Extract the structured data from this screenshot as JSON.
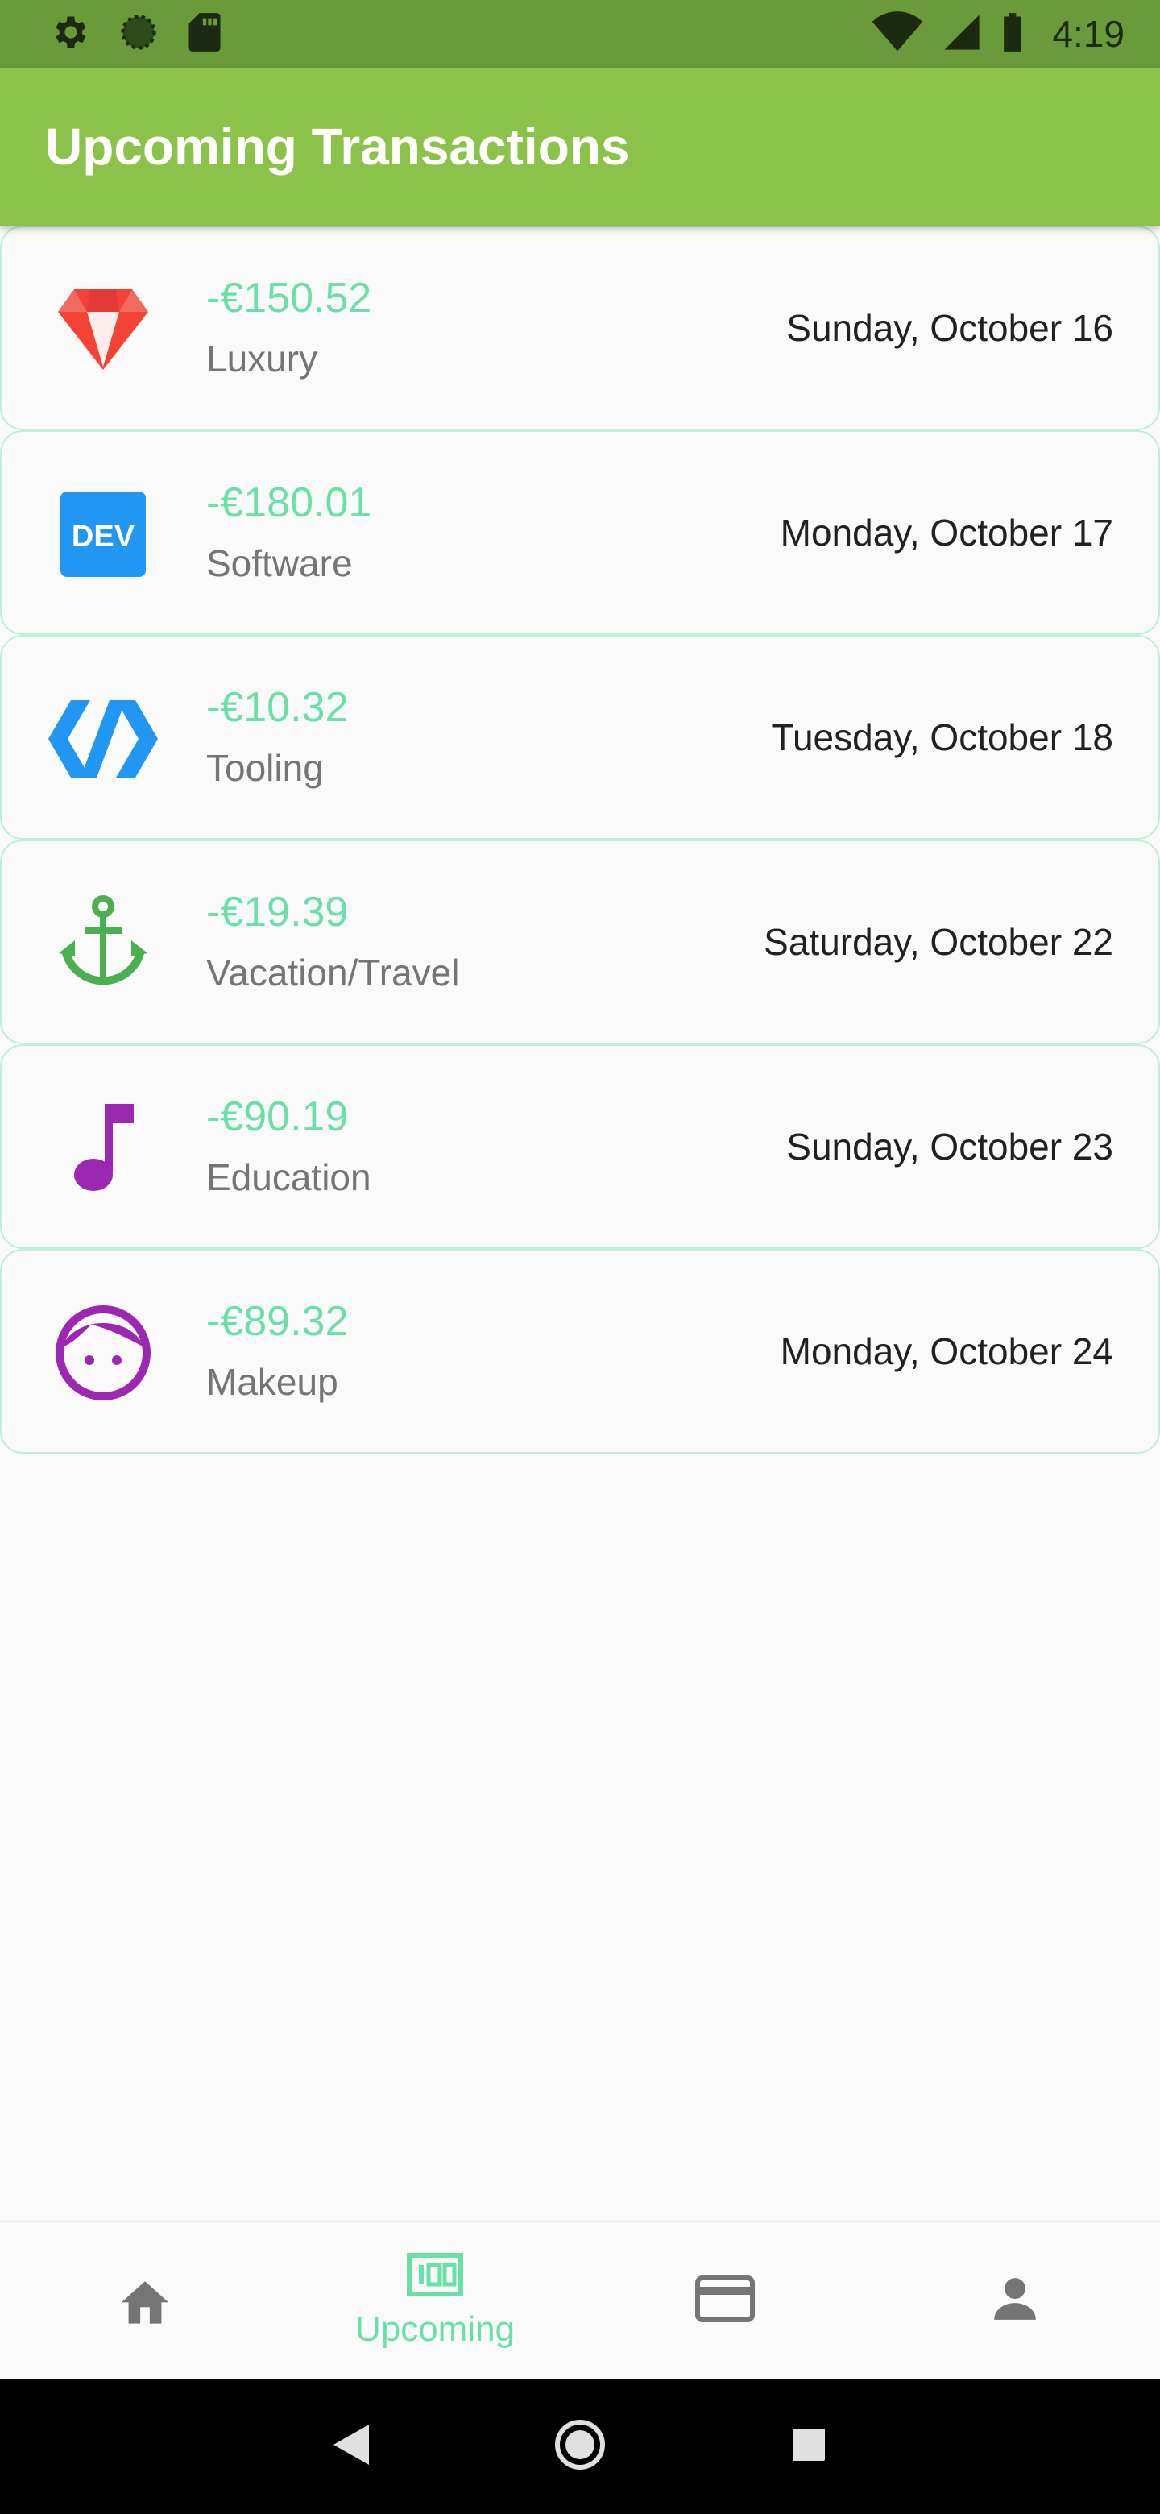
{
  "status_bar": {
    "time": "4:19",
    "icons_left": [
      "gear-icon",
      "circle-status-icon",
      "sd-card-icon"
    ],
    "icons_right": [
      "wifi-icon",
      "signal-icon",
      "battery-icon"
    ]
  },
  "app_bar": {
    "title": "Upcoming Transactions"
  },
  "transactions": [
    {
      "amount": "-€150.52",
      "category": "Luxury",
      "date": "Sunday, October 16",
      "icon": "diamond-icon",
      "icon_color": "#f44336"
    },
    {
      "amount": "-€180.01",
      "category": "Software",
      "date": "Monday, October 17",
      "icon": "dev-icon",
      "icon_color": "#2196f3"
    },
    {
      "amount": "-€10.32",
      "category": "Tooling",
      "date": "Tuesday, October 18",
      "icon": "polymer-icon",
      "icon_color": "#2196f3"
    },
    {
      "amount": "-€19.39",
      "category": "Vacation/Travel",
      "date": "Saturday, October 22",
      "icon": "anchor-icon",
      "icon_color": "#4caf50"
    },
    {
      "amount": "-€90.19",
      "category": "Education",
      "date": "Sunday, October 23",
      "icon": "music-note-icon",
      "icon_color": "#9c27b0"
    },
    {
      "amount": "-€89.32",
      "category": "Makeup",
      "date": "Monday, October 24",
      "icon": "face-icon",
      "icon_color": "#9c27b0"
    }
  ],
  "bottom_nav": {
    "items": [
      {
        "icon": "home-icon",
        "label": ""
      },
      {
        "icon": "money-icon",
        "label": "Upcoming"
      },
      {
        "icon": "credit-card-icon",
        "label": ""
      },
      {
        "icon": "person-icon",
        "label": ""
      }
    ],
    "active_color": "#69e0a5",
    "inactive_color": "#757575"
  },
  "system_nav": {
    "icons": [
      "back-icon",
      "home-circle-icon",
      "recents-icon"
    ]
  },
  "colors": {
    "app_bar": "#8bc34a",
    "status_bar": "#6a9a3a",
    "amount": "#69e0a5",
    "card_border": "#bdf0d6"
  }
}
